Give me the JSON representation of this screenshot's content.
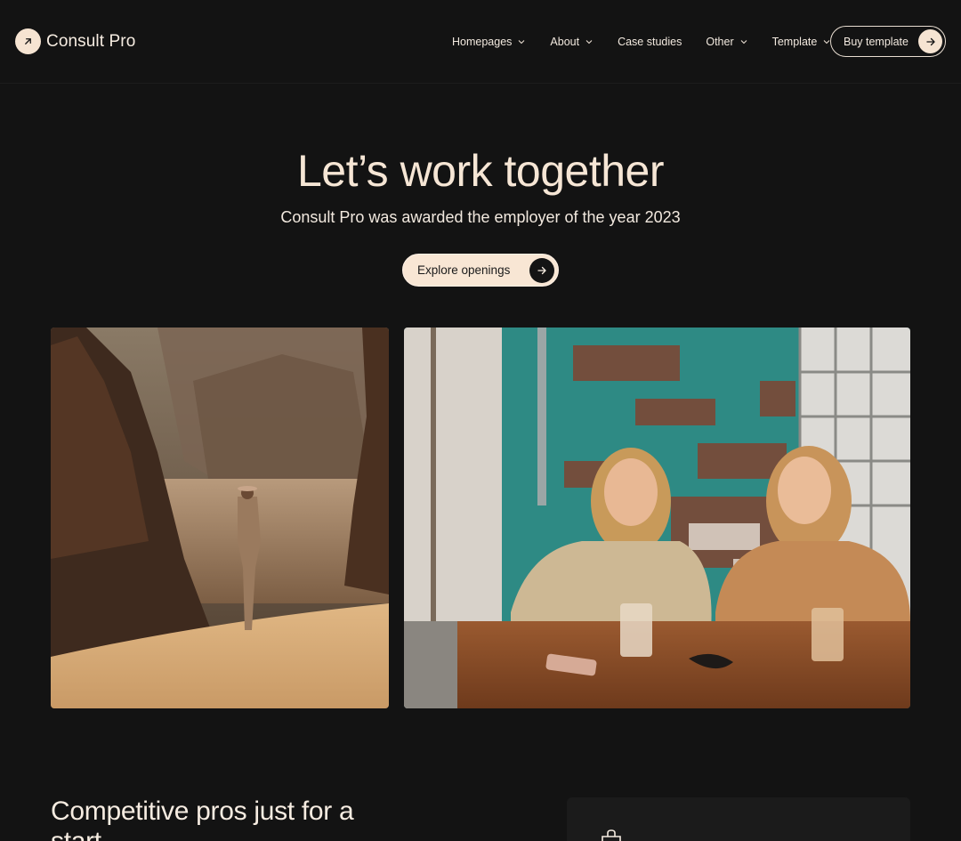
{
  "brand": {
    "name": "Consult Pro"
  },
  "nav": {
    "items": [
      {
        "label": "Homepages",
        "has_dropdown": true
      },
      {
        "label": "About",
        "has_dropdown": true
      },
      {
        "label": "Case studies",
        "has_dropdown": false
      },
      {
        "label": "Other",
        "has_dropdown": true
      },
      {
        "label": "Template",
        "has_dropdown": true
      }
    ],
    "cta_label": "Buy template"
  },
  "hero": {
    "title": "Let’s work together",
    "subtitle": "Consult Pro was awarded the employer of the year 2023",
    "button_label": "Explore openings"
  },
  "images": {
    "left": "desert-canyon-explorer-photo",
    "right": "two-women-cafe-photo"
  },
  "section": {
    "heading": "Competitive pros just for a start"
  },
  "colors": {
    "background": "#131313",
    "accent": "#f6e4d2",
    "text": "#f6ece1"
  },
  "icons": [
    "arrow-up-right-icon",
    "chevron-down-icon",
    "arrow-right-icon",
    "bag-icon"
  ]
}
